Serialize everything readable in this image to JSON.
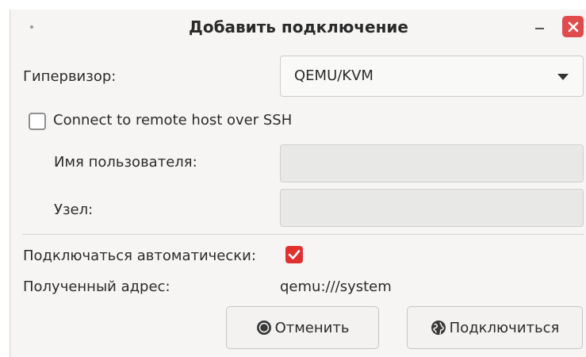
{
  "window": {
    "title": "Добавить подключение",
    "title_icon": "dot-icon",
    "minimize_icon": "minimize-icon",
    "close_icon": "close-icon"
  },
  "form": {
    "hypervisor_label": "Гипервизор:",
    "hypervisor_value": "QEMU/KVM",
    "ssh_checkbox_label": "Connect to remote host over SSH",
    "ssh_checked": false,
    "username_label": "Имя пользователя:",
    "username_value": "",
    "host_label": "Узел:",
    "host_value": "",
    "autoconnect_label": "Подключаться автоматически:",
    "autoconnect_checked": true,
    "generated_uri_label": "Полученный адрес:",
    "generated_uri_value": "qemu:///system"
  },
  "buttons": {
    "cancel_label": "Отменить",
    "cancel_icon": "stop-icon",
    "connect_label": "Подключиться",
    "connect_icon": "globe-icon"
  },
  "colors": {
    "accent": "#e0312f",
    "close": "#e24b4b",
    "background": "#f6f5f4"
  }
}
